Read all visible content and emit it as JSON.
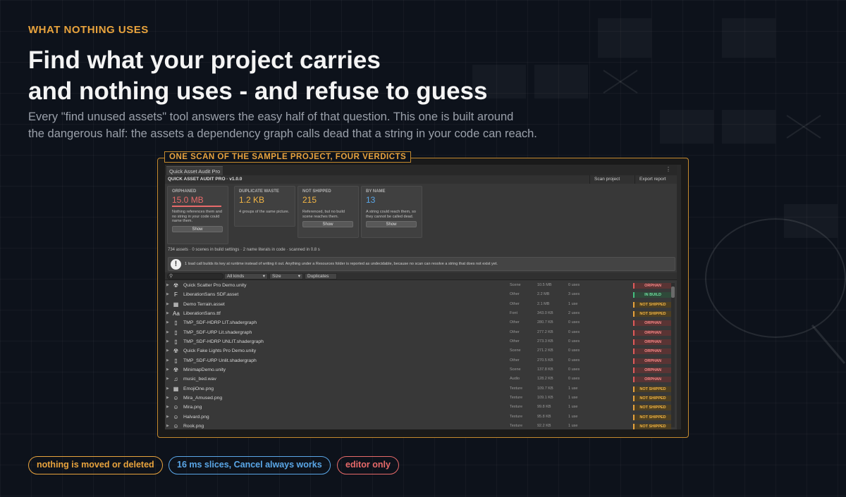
{
  "kicker": "WHAT NOTHING USES",
  "headline": [
    "Find what your project carries",
    "and nothing uses - and refuse to guess"
  ],
  "subtitle": [
    "Every \"find unused assets\" tool answers the easy half of that question. This one is built around",
    "the dangerous half: the assets a dependency graph calls dead that a string in your code can reach."
  ],
  "frame_title": "ONE SCAN OF THE SAMPLE PROJECT, FOUR VERDICTS",
  "window": {
    "tab": "Quick Asset Audit Pro",
    "menu_icon": "⋮",
    "title": "QUICK ASSET AUDIT PRO",
    "version": "v1.0.0",
    "scan_button": "Scan project",
    "export_button": "Export report"
  },
  "cards": [
    {
      "label": "ORPHANED",
      "value": "15.0 MB",
      "desc": "Nothing references them and no string in your code could name them.",
      "show": "Show",
      "color": "#e86a6a",
      "underline": true
    },
    {
      "label": "DUPLICATE WASTE",
      "value": "1.2 KB",
      "desc": "4 groups of the same picture.",
      "show": "",
      "color": "#f2b544",
      "underline": false
    },
    {
      "label": "NOT SHIPPED",
      "value": "215",
      "desc": "Referenced, but no build scene reaches them.",
      "show": "Show",
      "color": "#f2b544",
      "underline": false
    },
    {
      "label": "BY NAME",
      "value": "13",
      "desc": "A string could reach them, so they cannot be called dead.",
      "show": "Show",
      "color": "#5aa7e8",
      "underline": false
    }
  ],
  "summary": "734 assets · 0 scenes in build settings · 2 name literals in code · scanned in 0.8 s",
  "note": "1 load call builds its key at runtime instead of writing it out. Anything under a Resources folder is reported as undecidable, because no scan can resolve a string that does not exist yet.",
  "filters": {
    "kind": "All kinds",
    "size": "Size",
    "duplicates": "Duplicates"
  },
  "rows": [
    {
      "icon": "scene-icon",
      "glyph": "☢",
      "name": "Quick Scatter Pro Demo.unity",
      "kind": "Scene",
      "size": "10.5 MB",
      "uses": "0 uses",
      "verdict": "ORPHAN",
      "vclass": "v-orphan"
    },
    {
      "icon": "font-asset-icon",
      "glyph": "F",
      "name": "LiberationSans SDF.asset",
      "kind": "Other",
      "size": "2.2 MB",
      "uses": "3 uses",
      "verdict": "IN BUILD",
      "vclass": "v-inbuild"
    },
    {
      "icon": "terrain-icon",
      "glyph": "▦",
      "name": "Demo Terrain.asset",
      "kind": "Other",
      "size": "2.1 MB",
      "uses": "1 use",
      "verdict": "NOT SHIPPED",
      "vclass": "v-notshipped"
    },
    {
      "icon": "font-icon",
      "glyph": "Aa",
      "name": "LiberationSans.ttf",
      "kind": "Font",
      "size": "343.0 KB",
      "uses": "2 uses",
      "verdict": "NOT SHIPPED",
      "vclass": "v-notshipped"
    },
    {
      "icon": "file-icon",
      "glyph": "▯",
      "name": "TMP_SDF-HDRP LIT.shadergraph",
      "kind": "Other",
      "size": "280.7 KB",
      "uses": "0 uses",
      "verdict": "ORPHAN",
      "vclass": "v-orphan"
    },
    {
      "icon": "file-icon",
      "glyph": "▯",
      "name": "TMP_SDF-URP Lit.shadergraph",
      "kind": "Other",
      "size": "277.2 KB",
      "uses": "0 uses",
      "verdict": "ORPHAN",
      "vclass": "v-orphan"
    },
    {
      "icon": "file-icon",
      "glyph": "▯",
      "name": "TMP_SDF-HDRP UNLIT.shadergraph",
      "kind": "Other",
      "size": "273.3 KB",
      "uses": "0 uses",
      "verdict": "ORPHAN",
      "vclass": "v-orphan"
    },
    {
      "icon": "scene-icon",
      "glyph": "☢",
      "name": "Quick Fake Lights Pro Demo.unity",
      "kind": "Scene",
      "size": "271.2 KB",
      "uses": "0 uses",
      "verdict": "ORPHAN",
      "vclass": "v-orphan"
    },
    {
      "icon": "file-icon",
      "glyph": "▯",
      "name": "TMP_SDF-URP Unlit.shadergraph",
      "kind": "Other",
      "size": "270.5 KB",
      "uses": "0 uses",
      "verdict": "ORPHAN",
      "vclass": "v-orphan"
    },
    {
      "icon": "scene-icon",
      "glyph": "☢",
      "name": "MinimapDemo.unity",
      "kind": "Scene",
      "size": "137.8 KB",
      "uses": "0 uses",
      "verdict": "ORPHAN",
      "vclass": "v-orphan"
    },
    {
      "icon": "audio-icon",
      "glyph": "♫",
      "name": "music_bed.wav",
      "kind": "Audio",
      "size": "128.2 KB",
      "uses": "0 uses",
      "verdict": "ORPHAN",
      "vclass": "v-orphan"
    },
    {
      "icon": "texture-icon",
      "glyph": "▦",
      "name": "EmojiOne.png",
      "kind": "Texture",
      "size": "109.7 KB",
      "uses": "1 use",
      "verdict": "NOT SHIPPED",
      "vclass": "v-notshipped"
    },
    {
      "icon": "texture-icon",
      "glyph": "☺",
      "name": "Mira_Amused.png",
      "kind": "Texture",
      "size": "109.1 KB",
      "uses": "1 use",
      "verdict": "NOT SHIPPED",
      "vclass": "v-notshipped"
    },
    {
      "icon": "texture-icon",
      "glyph": "☺",
      "name": "Mira.png",
      "kind": "Texture",
      "size": "99.8 KB",
      "uses": "1 use",
      "verdict": "NOT SHIPPED",
      "vclass": "v-notshipped"
    },
    {
      "icon": "texture-icon",
      "glyph": "☺",
      "name": "Halvard.png",
      "kind": "Texture",
      "size": "95.8 KB",
      "uses": "1 use",
      "verdict": "NOT SHIPPED",
      "vclass": "v-notshipped"
    },
    {
      "icon": "texture-icon",
      "glyph": "☺",
      "name": "Rook.png",
      "kind": "Texture",
      "size": "92.2 KB",
      "uses": "1 use",
      "verdict": "NOT SHIPPED",
      "vclass": "v-notshipped"
    }
  ],
  "pills": [
    {
      "text": "nothing is moved or deleted",
      "color": "#e8a33d"
    },
    {
      "text": "16 ms slices, Cancel always works",
      "color": "#5aa7e8"
    },
    {
      "text": "editor only",
      "color": "#e86a6a"
    }
  ]
}
